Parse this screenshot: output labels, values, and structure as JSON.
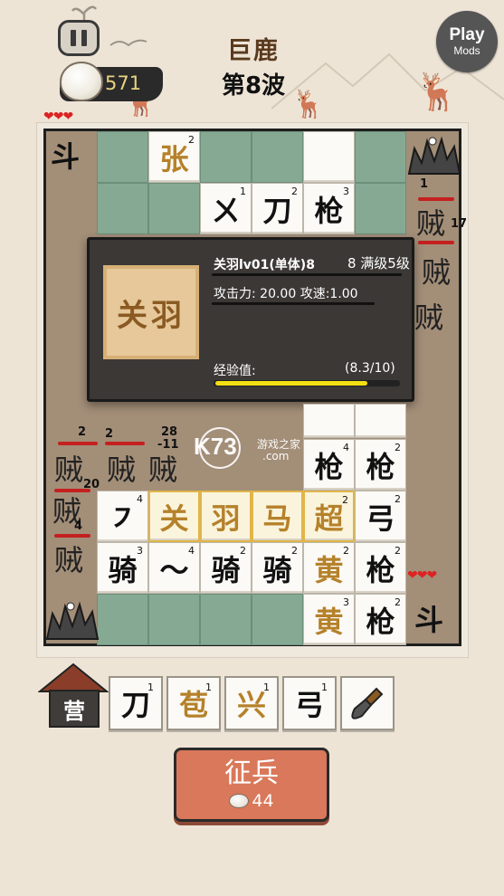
{
  "overlay": {
    "play_title": "Play",
    "play_subtitle": "Mods"
  },
  "header": {
    "level_name": "巨鹿",
    "wave": "第8波",
    "coins": "571",
    "hearts_top": "❤❤❤",
    "hearts_bottom": "❤❤❤"
  },
  "board": {
    "flag_top": "斗",
    "flag_bottom": "斗",
    "top_tiles": [
      {
        "char": "张",
        "level": "2",
        "gold": true
      },
      {
        "char": "ㄨ",
        "level": "1",
        "gold": false
      },
      {
        "char": "刀",
        "level": "2",
        "gold": false
      },
      {
        "char": "枪",
        "level": "3",
        "gold": false
      }
    ],
    "grid_row1": [
      {
        "char": "㇇",
        "level": "4",
        "gold": false
      },
      {
        "char": "关",
        "level": "",
        "gold": true
      },
      {
        "char": "羽",
        "level": "",
        "gold": true
      },
      {
        "char": "马",
        "level": "",
        "gold": true
      },
      {
        "char": "超",
        "level": "2",
        "gold": true
      },
      {
        "char": "弓",
        "level": "2",
        "gold": false
      }
    ],
    "grid_row2": [
      {
        "char": "骑",
        "level": "3",
        "gold": false
      },
      {
        "char": "〜",
        "level": "4",
        "gold": false
      },
      {
        "char": "骑",
        "level": "2",
        "gold": false
      },
      {
        "char": "骑",
        "level": "2",
        "gold": false
      },
      {
        "char": "黄",
        "level": "2",
        "gold": true
      },
      {
        "char": "枪",
        "level": "2",
        "gold": false
      }
    ],
    "grid_row0": [
      {
        "char": "枪",
        "level": "4"
      },
      {
        "char": "枪",
        "level": "2"
      }
    ],
    "grid_row3": [
      {
        "char": "黄",
        "level": "3",
        "gold": true
      },
      {
        "char": "枪",
        "level": "2",
        "gold": false
      }
    ],
    "enemies": {
      "right_1": "贼",
      "right_2": "贼",
      "right_3": "贼",
      "left_1": "贼",
      "left_2": "贼",
      "left_3": "贼",
      "left_4": "贼",
      "mid_1": "贼",
      "dmg_a": "2",
      "dmg_b": "2",
      "dmg_c": "28",
      "dmg_d": "-11",
      "dmg_e": "20",
      "dmg_f": "4",
      "dmg_g": "1",
      "dmg_h": "17"
    }
  },
  "popup": {
    "portrait": "关羽",
    "name_line": "关羽lv01(单体)8",
    "level": "8 满级5级",
    "stats": "攻击力: 20.00 攻速:1.00",
    "exp_label": "经验值:",
    "exp_value": "(8.3/10)",
    "exp_progress": 0.83
  },
  "watermark": {
    "logo": "K73",
    "text": "游戏之家",
    "domain": ".com"
  },
  "shop": {
    "camp": "营",
    "slots": [
      {
        "char": "刀",
        "level": "1",
        "gold": false
      },
      {
        "char": "苞",
        "level": "1",
        "gold": true
      },
      {
        "char": "兴",
        "level": "1",
        "gold": true
      },
      {
        "char": "弓",
        "level": "1",
        "gold": false
      }
    ],
    "shovel_icon": "shovel-icon",
    "recruit_label": "征兵",
    "recruit_cost": "44"
  }
}
